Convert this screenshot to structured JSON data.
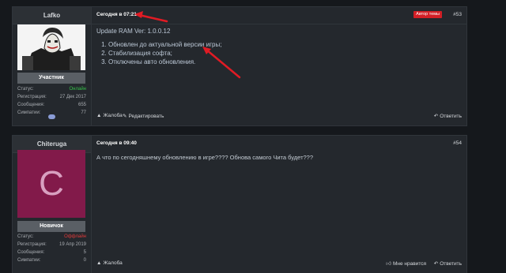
{
  "posts": [
    {
      "username": "Lafko",
      "role": "Участник",
      "stats": [
        {
          "label": "Статус:",
          "value": "Онлайн"
        },
        {
          "label": "Регистрация:",
          "value": "27 Дек 2017"
        },
        {
          "label": "Сообщения:",
          "value": "655"
        },
        {
          "label": "Симпатии:",
          "value": "77"
        }
      ],
      "date": "Сегодня в 07:21",
      "author_badge": "Автор темы",
      "number": "#53",
      "title": "Update RAM Ver: 1.0.0.12",
      "items": [
        "Обновлен до актуальной версии игры;",
        "Стабилизация софта;",
        "Отключены авто обновления."
      ],
      "actions": {
        "report": "Жалоба",
        "edit": "Редактировать",
        "reply": "Ответить"
      }
    },
    {
      "username": "Chiteruga",
      "avatar_letter": "C",
      "role": "Новичок",
      "stats": [
        {
          "label": "Статус:",
          "value": "Оффлайн"
        },
        {
          "label": "Регистрация:",
          "value": "19 Апр 2019"
        },
        {
          "label": "Сообщения:",
          "value": "5"
        },
        {
          "label": "Симпатии:",
          "value": "0"
        }
      ],
      "date": "Сегодня в 09:40",
      "number": "#54",
      "text": "А что по сегодняшнему обновлению в игре???? Обнова самого Чита будет???",
      "actions": {
        "report": "Жалоба",
        "like": "Мне нравится",
        "reply": "Ответить"
      }
    }
  ],
  "colors": {
    "online": "#35c24a",
    "offline": "#e03a3a",
    "badge": "#d21f26",
    "annotation": "#e01b24"
  }
}
